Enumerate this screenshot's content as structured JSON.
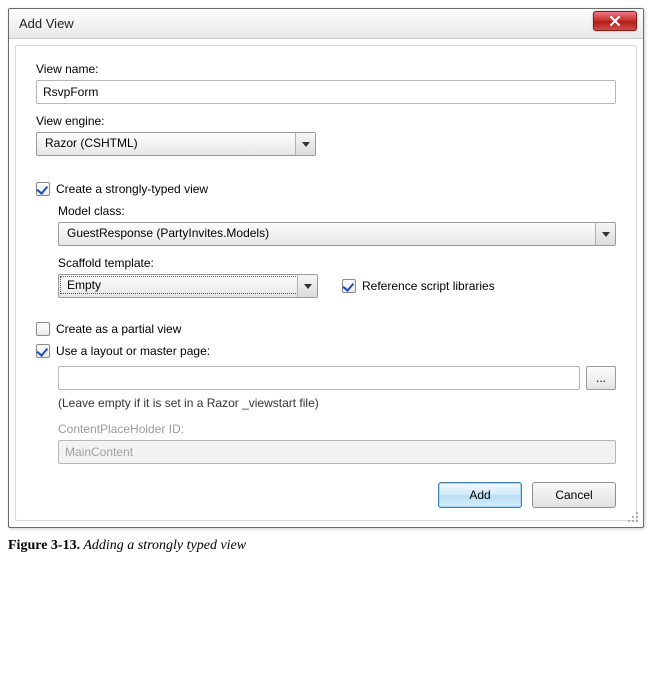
{
  "window": {
    "title": "Add View"
  },
  "fields": {
    "viewNameLabel": "View name:",
    "viewNameValue": "RsvpForm",
    "viewEngineLabel": "View engine:",
    "viewEngineValue": "Razor (CSHTML)",
    "stronglyTypedLabel": "Create a strongly-typed view",
    "modelClassLabel": "Model class:",
    "modelClassValue": "GuestResponse (PartyInvites.Models)",
    "scaffoldLabel": "Scaffold template:",
    "scaffoldValue": "Empty",
    "refScriptLabel": "Reference script libraries",
    "partialViewLabel": "Create as a partial view",
    "useLayoutLabel": "Use a layout or master page:",
    "layoutPathValue": "",
    "layoutHint": "(Leave empty if it is set in a Razor _viewstart file)",
    "cphLabel": "ContentPlaceHolder ID:",
    "cphValue": "MainContent",
    "browseBtn": "..."
  },
  "buttons": {
    "add": "Add",
    "cancel": "Cancel"
  },
  "caption": {
    "figure": "Figure 3-13.",
    "text": " Adding a strongly typed view"
  }
}
